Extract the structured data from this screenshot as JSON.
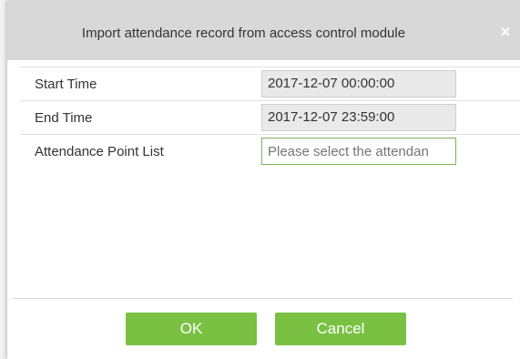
{
  "dialog": {
    "title": "Import attendance record from access control module",
    "close_glyph": "×"
  },
  "form": {
    "start_time_label": "Start Time",
    "start_time_value": "2017-12-07 00:00:00",
    "end_time_label": "End Time",
    "end_time_value": "2017-12-07 23:59:00",
    "attendance_point_label": "Attendance Point List",
    "attendance_point_placeholder": "Please select the attendan"
  },
  "buttons": {
    "ok_label": "OK",
    "cancel_label": "Cancel"
  },
  "colors": {
    "accent": "#7ac143",
    "title_bar": "#d8d8d8"
  }
}
